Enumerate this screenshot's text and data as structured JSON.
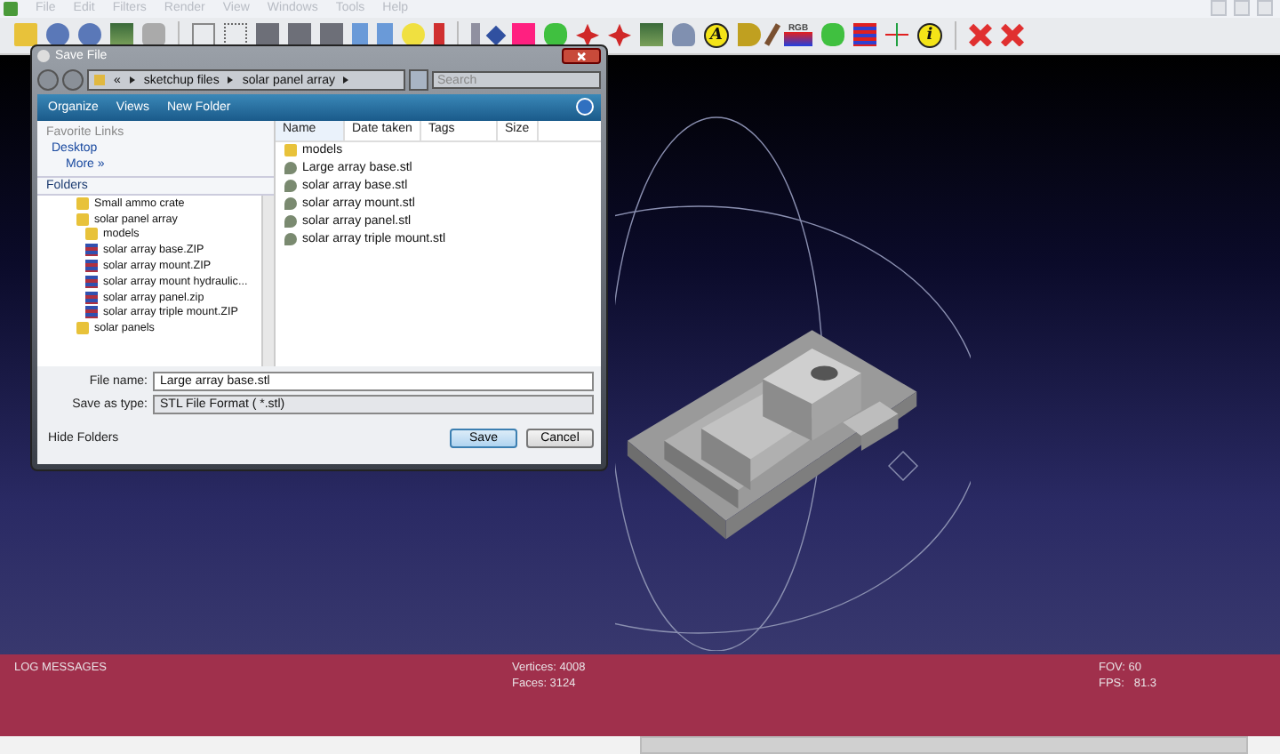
{
  "menu": [
    "File",
    "Edit",
    "Filters",
    "Render",
    "View",
    "Windows",
    "Tools",
    "Help"
  ],
  "toolbar": {
    "letters": [
      "A",
      "i"
    ],
    "rgb_label": "RGB"
  },
  "dialog": {
    "title": "Save File",
    "breadcrumb": [
      "«",
      "sketchup files",
      "solar panel array"
    ],
    "search": {
      "placeholder": "Search"
    },
    "commands": [
      "Organize",
      "Views",
      "New Folder"
    ],
    "favorites_heading": "Favorite Links",
    "favorites": [
      {
        "label": "Desktop",
        "kind": "desktop"
      },
      {
        "label": "More »",
        "kind": "more"
      }
    ],
    "folders_heading": "Folders",
    "tree": [
      {
        "label": "Small ammo crate",
        "kind": "folder"
      },
      {
        "label": "solar panel array",
        "kind": "folder",
        "children": [
          {
            "label": "models",
            "kind": "folder"
          },
          {
            "label": "solar array base.ZIP",
            "kind": "zip"
          },
          {
            "label": "solar array mount.ZIP",
            "kind": "zip"
          },
          {
            "label": "solar array mount hydraulic...",
            "kind": "zip"
          },
          {
            "label": "solar array panel.zip",
            "kind": "zip"
          },
          {
            "label": "solar array triple mount.ZIP",
            "kind": "zip"
          }
        ]
      },
      {
        "label": "solar panels",
        "kind": "folder"
      }
    ],
    "columns": [
      "Name",
      "Date taken",
      "Tags",
      "Size"
    ],
    "files": [
      {
        "name": "models",
        "kind": "folder"
      },
      {
        "name": "Large array base.stl",
        "kind": "stl"
      },
      {
        "name": "solar array base.stl",
        "kind": "stl"
      },
      {
        "name": "solar array mount.stl",
        "kind": "stl"
      },
      {
        "name": "solar array panel.stl",
        "kind": "stl"
      },
      {
        "name": "solar array triple mount.stl",
        "kind": "stl"
      }
    ],
    "file_name_label": "File name:",
    "file_name": "Large array base.stl",
    "type_label": "Save as type:",
    "type_value": "STL File Format ( *.stl)",
    "hide_folders": "Hide Folders",
    "buttons": [
      "Save",
      "Cancel"
    ]
  },
  "log": {
    "title": "LOG MESSAGES",
    "vertices": "Vertices: 4008",
    "faces": "Faces: 3124",
    "fov": "FOV: 60",
    "fps": "FPS:   81.3"
  }
}
